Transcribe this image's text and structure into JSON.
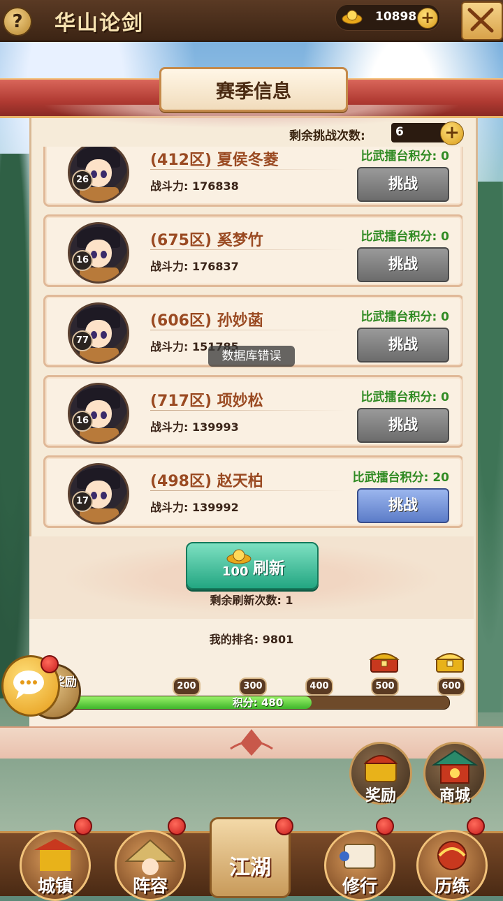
{
  "header": {
    "title": "华山论剑",
    "help_icon": "?",
    "gold_value": "10898",
    "gold_plus": "+"
  },
  "season": {
    "title": "赛季信息",
    "attempts_label": "剩余挑战次数:",
    "attempts_value": "6",
    "attempts_plus": "+"
  },
  "opponents": [
    {
      "level": "26",
      "name": "(412区) 夏侯冬菱",
      "power": "战斗力: 176838",
      "score": "比武擂台积分: 0",
      "button": "挑战",
      "active": false
    },
    {
      "level": "16",
      "name": "(675区) 奚梦竹",
      "power": "战斗力: 176837",
      "score": "比武擂台积分: 0",
      "button": "挑战",
      "active": false
    },
    {
      "level": "77",
      "name": "(606区) 孙妙菡",
      "power": "战斗力: 151785",
      "score": "比武擂台积分: 0",
      "button": "挑战",
      "active": false
    },
    {
      "level": "16",
      "name": "(717区) 项妙松",
      "power": "战斗力: 139993",
      "score": "比武擂台积分: 0",
      "button": "挑战",
      "active": false
    },
    {
      "level": "17",
      "name": "(498区) 赵天柏",
      "power": "战斗力: 139992",
      "score": "比武擂台积分: 20",
      "button": "挑战",
      "active": true
    }
  ],
  "toast": "数据库错误",
  "refresh": {
    "cost": "100",
    "label": "刷新",
    "remaining": "剩余刷新次数: 1"
  },
  "rank": {
    "text": "我的排名: 9801"
  },
  "score_progress": {
    "label": "积分: 480",
    "current": 480,
    "max": 600,
    "milestones": [
      "200",
      "300",
      "400",
      "500",
      "600"
    ],
    "reward_badge": "积分奖励"
  },
  "side_buttons": {
    "reward": "奖励",
    "shop": "商城"
  },
  "nav": {
    "town": "城镇",
    "lineup": "阵容",
    "jianghu": "江湖",
    "training": "修行",
    "trial": "历练"
  },
  "colors": {
    "accent_gold": "#d89a18",
    "score_green": "#2f8a22",
    "name_brown": "#9a4a22",
    "refresh_teal": "#23a682"
  }
}
